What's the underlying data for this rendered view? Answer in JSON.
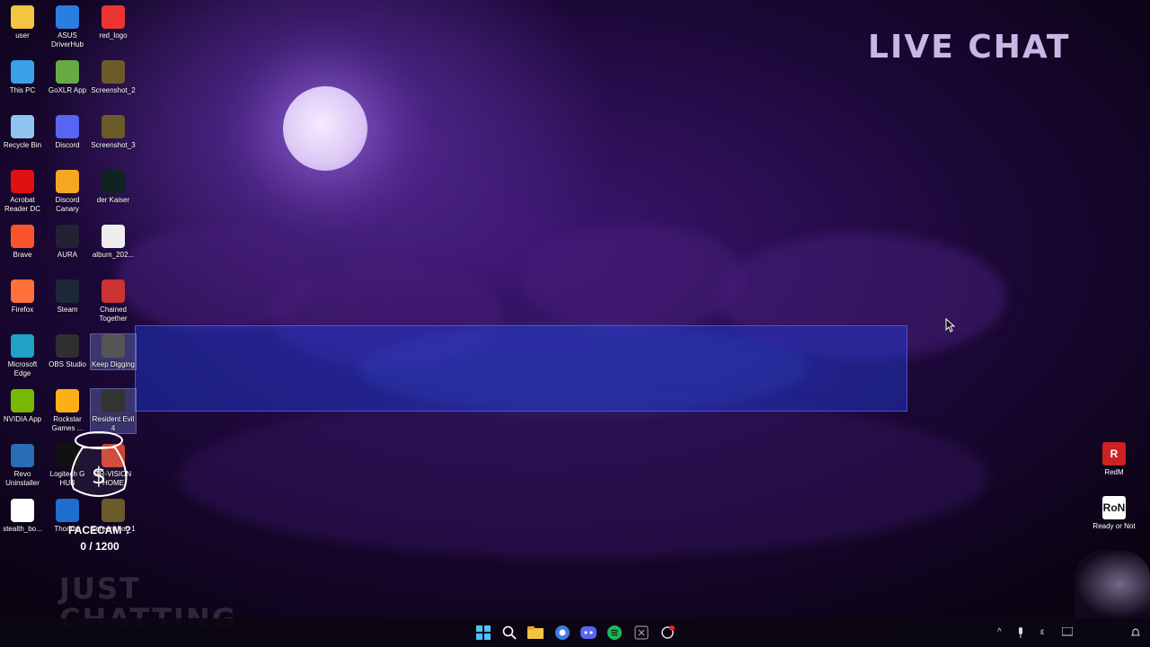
{
  "overlay": {
    "live_chat": "LIVE CHAT",
    "facecam_label": "FACECAM ?",
    "facecam_count": "0 / 1200",
    "just_chatting": "JUST CHATTING"
  },
  "desktop_icons": [
    {
      "label": "user",
      "icon": "folder-icon",
      "color": "#f4c542"
    },
    {
      "label": "ASUS DriverHub",
      "icon": "gear-icon",
      "color": "#2a7de1"
    },
    {
      "label": "red_logo",
      "icon": "image-icon",
      "color": "#e33"
    },
    {
      "label": "This PC",
      "icon": "monitor-icon",
      "color": "#3aa0e8"
    },
    {
      "label": "GoXLR App",
      "icon": "app-icon",
      "color": "#6a4"
    },
    {
      "label": "Screenshot_2",
      "icon": "image-icon",
      "color": "#6b5a2a"
    },
    {
      "label": "Recycle Bin",
      "icon": "recycle-bin-icon",
      "color": "#8fc3f0"
    },
    {
      "label": "Discord",
      "icon": "discord-icon",
      "color": "#5865f2"
    },
    {
      "label": "Screenshot_3",
      "icon": "image-icon",
      "color": "#6b5a2a"
    },
    {
      "label": "Acrobat Reader DC",
      "icon": "pdf-icon",
      "color": "#d11"
    },
    {
      "label": "Discord Canary",
      "icon": "discord-canary-icon",
      "color": "#f5a623"
    },
    {
      "label": "der Kaiser",
      "icon": "image-icon",
      "color": "#122"
    },
    {
      "label": "Brave",
      "icon": "brave-icon",
      "color": "#fb542b"
    },
    {
      "label": "AURA",
      "icon": "aura-icon",
      "color": "#223"
    },
    {
      "label": "album_202...",
      "icon": "image-icon",
      "color": "#eee"
    },
    {
      "label": "Firefox",
      "icon": "firefox-icon",
      "color": "#ff7139"
    },
    {
      "label": "Steam",
      "icon": "steam-icon",
      "color": "#1b2838"
    },
    {
      "label": "Chained Together",
      "icon": "game-icon",
      "color": "#c33"
    },
    {
      "label": "Microsoft Edge",
      "icon": "edge-icon",
      "color": "#1fa2c6"
    },
    {
      "label": "OBS Studio",
      "icon": "obs-icon",
      "color": "#302e31"
    },
    {
      "label": "Keep Digging",
      "icon": "game-icon",
      "color": "#555"
    },
    {
      "label": "NVIDIA App",
      "icon": "nvidia-icon",
      "color": "#76b900"
    },
    {
      "label": "Rockstar Games ...",
      "icon": "rockstar-icon",
      "color": "#fcaf17"
    },
    {
      "label": "Resident Evil 4",
      "icon": "game-icon",
      "color": "#333"
    },
    {
      "label": "Revo Uninstaller",
      "icon": "revo-icon",
      "color": "#2a6db5"
    },
    {
      "label": "Logitech G HUB",
      "icon": "logitech-icon",
      "color": "#111"
    },
    {
      "label": "TR-VISION HOME",
      "icon": "trvision-icon",
      "color": "#c43"
    },
    {
      "label": "stealth_bo...",
      "icon": "app-icon",
      "color": "#fff"
    },
    {
      "label": "Thorium",
      "icon": "thorium-icon",
      "color": "#1e6ed0"
    },
    {
      "label": "Screenshot_1",
      "icon": "image-icon",
      "color": "#6b5a2a"
    }
  ],
  "right_icons": [
    {
      "label": "RedM",
      "icon": "redm-icon",
      "color": "#c22"
    },
    {
      "label": "Ready or Not",
      "icon": "ready-or-not-icon",
      "color": "#fff"
    }
  ],
  "taskbar": {
    "apps": [
      "windows-start-icon",
      "search-icon",
      "file-explorer-icon",
      "chrome-icon",
      "discord-icon",
      "spotify-icon",
      "excel-icon",
      "app-icon"
    ],
    "tray_lang": "ε"
  }
}
